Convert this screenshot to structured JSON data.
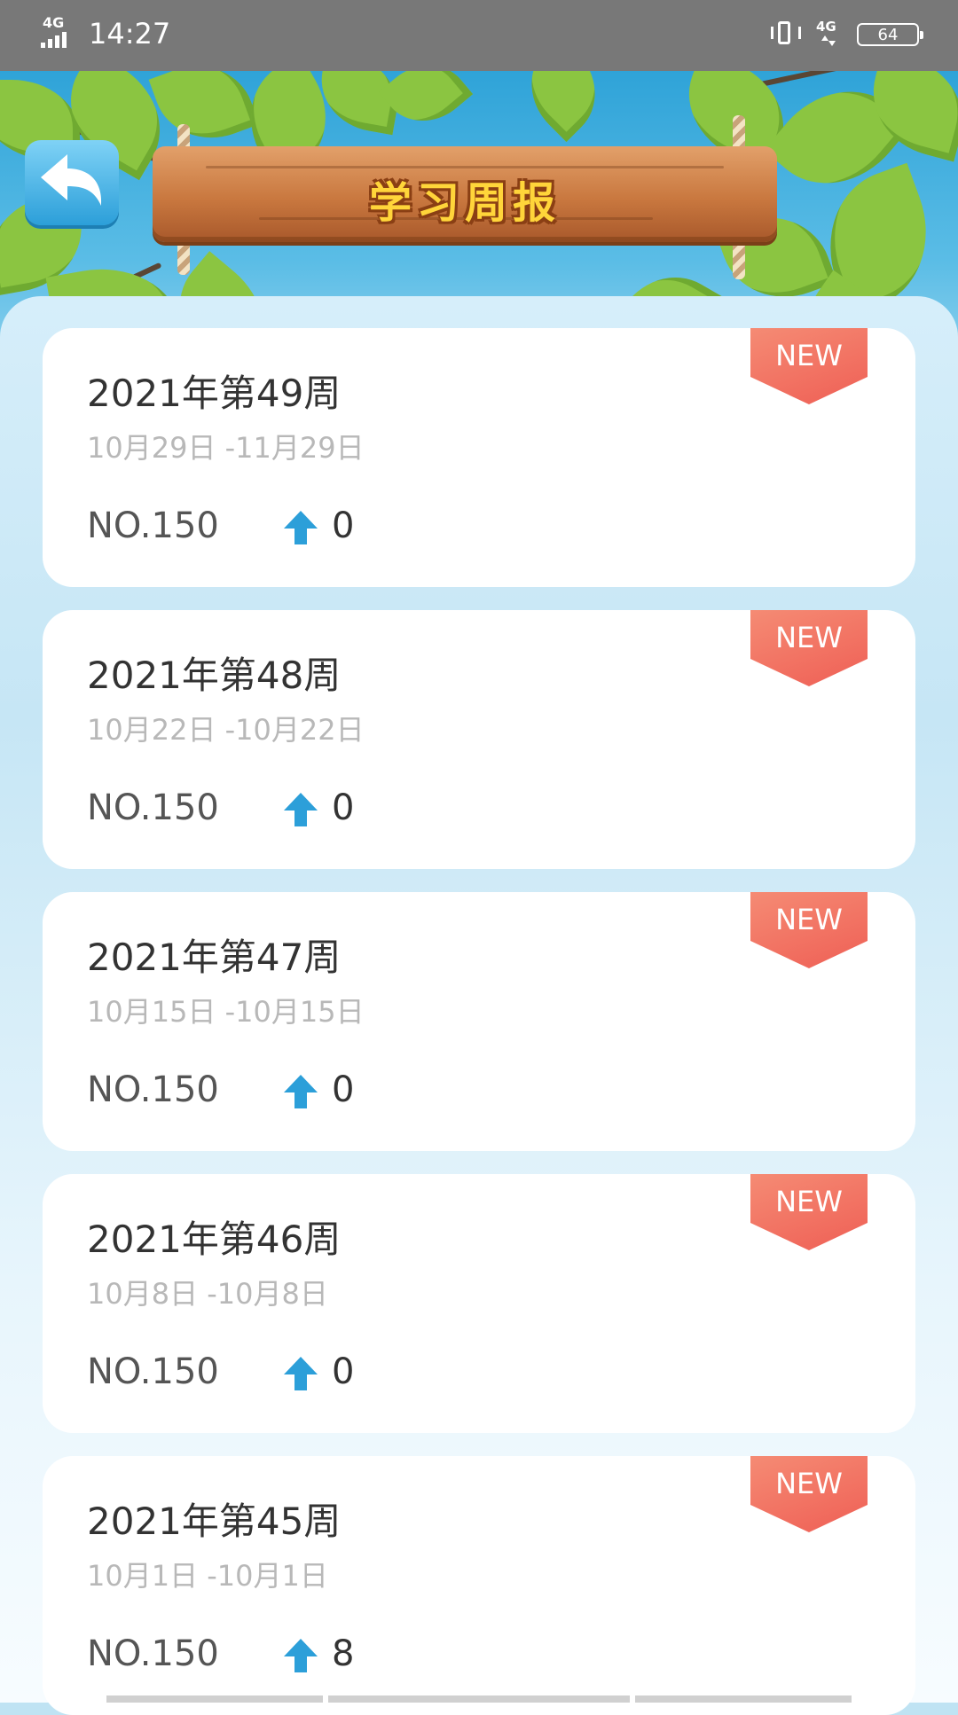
{
  "status_bar": {
    "network_left": "4G",
    "time": "14:27",
    "network_right": "4G",
    "battery": "64"
  },
  "header": {
    "title": "学习周报",
    "back_icon": "back-arrow-icon"
  },
  "reports": [
    {
      "week": "2021年第49周",
      "range": "10月29日 -11月29日",
      "rank": "NO.150",
      "change": "0",
      "badge": "NEW"
    },
    {
      "week": "2021年第48周",
      "range": "10月22日 -10月22日",
      "rank": "NO.150",
      "change": "0",
      "badge": "NEW"
    },
    {
      "week": "2021年第47周",
      "range": "10月15日 -10月15日",
      "rank": "NO.150",
      "change": "0",
      "badge": "NEW"
    },
    {
      "week": "2021年第46周",
      "range": "10月8日 -10月8日",
      "rank": "NO.150",
      "change": "0",
      "badge": "NEW"
    },
    {
      "week": "2021年第45周",
      "range": "10月1日 -10月1日",
      "rank": "NO.150",
      "change": "8",
      "badge": "NEW"
    }
  ],
  "colors": {
    "accent_blue": "#2c9fd9",
    "badge_red": "#ef5f55",
    "sign_text": "#ffd53a"
  }
}
